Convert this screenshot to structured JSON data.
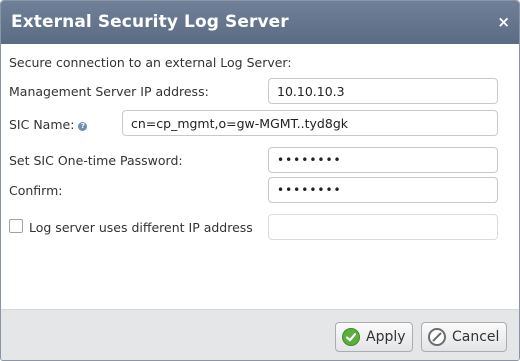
{
  "dialog": {
    "title": "External Security Log Server",
    "close_glyph": "×"
  },
  "form": {
    "intro": "Secure connection to an external Log Server:",
    "mgmt_ip_label": "Management Server IP address:",
    "mgmt_ip_value": "10.10.10.3",
    "sic_name_label": "SIC Name:",
    "sic_name_help_icon": "?",
    "sic_name_value": "cn=cp_mgmt,o=gw-MGMT..tyd8gk",
    "sic_password_label": "Set SIC One-time Password:",
    "sic_password_value": "••••••••",
    "confirm_label": "Confirm:",
    "confirm_value": "••••••••",
    "different_ip_label": "Log server uses different IP address",
    "different_ip_checked": false,
    "different_ip_value": ""
  },
  "footer": {
    "apply_label": "Apply",
    "cancel_label": "Cancel"
  },
  "colors": {
    "titlebar": "#5f6f87",
    "apply_icon": "#5cae3d",
    "footer_bg": "#e5e6e8"
  }
}
